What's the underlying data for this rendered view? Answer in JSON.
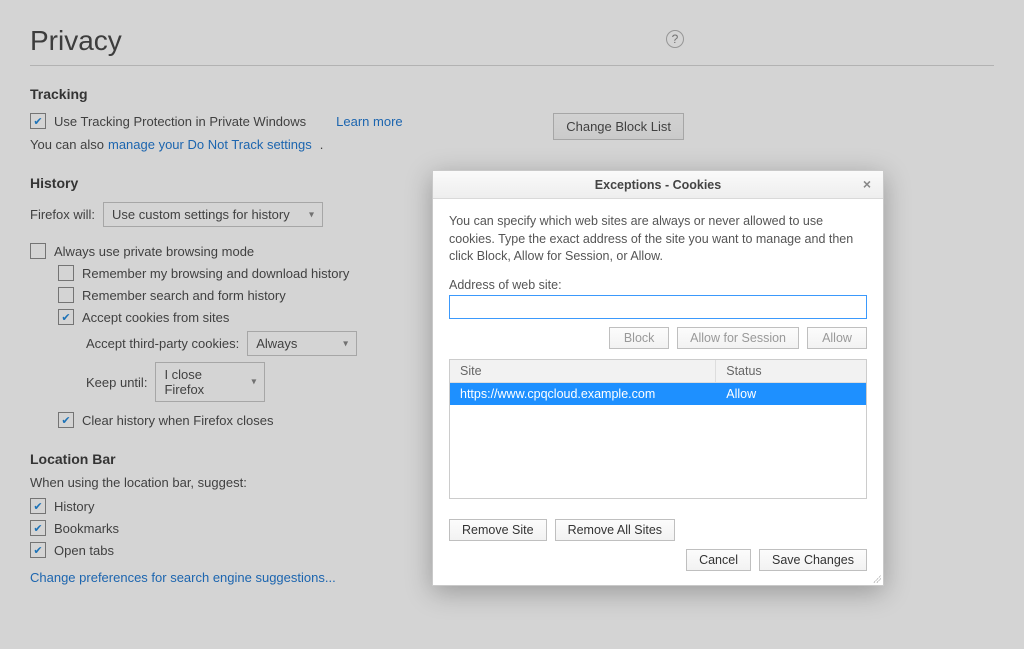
{
  "page": {
    "title": "Privacy",
    "help_icon_glyph": "?"
  },
  "tracking": {
    "heading": "Tracking",
    "use_private_label": "Use Tracking Protection in Private Windows",
    "learn_more": "Learn more",
    "change_block_list": "Change Block List",
    "manage_prefix": "You can also ",
    "manage_link": "manage your Do Not Track settings",
    "manage_suffix": "."
  },
  "history": {
    "heading": "History",
    "firefox_will_label": "Firefox will:",
    "firefox_will_value": "Use custom settings for history",
    "always_private": "Always use private browsing mode",
    "remember_browsing": "Remember my browsing and download history",
    "remember_search": "Remember search and form history",
    "accept_cookies": "Accept cookies from sites",
    "accept_third_label": "Accept third-party cookies:",
    "accept_third_value": "Always",
    "keep_until_label": "Keep until:",
    "keep_until_value": "I close Firefox",
    "clear_history": "Clear history when Firefox closes"
  },
  "locationbar": {
    "heading": "Location Bar",
    "desc": "When using the location bar, suggest:",
    "history": "History",
    "bookmarks": "Bookmarks",
    "open_tabs": "Open tabs",
    "change_search_prefs": "Change preferences for search engine suggestions..."
  },
  "modal": {
    "title": "Exceptions - Cookies",
    "desc": "You can specify which web sites are always or never allowed to use cookies. Type the exact address of the site you want to manage and then click Block, Allow for Session, or Allow.",
    "address_label": "Address of web site:",
    "address_value": "",
    "block": "Block",
    "allow_session": "Allow for Session",
    "allow": "Allow",
    "col_site": "Site",
    "col_status": "Status",
    "row_site": "https://www.cpqcloud.example.com",
    "row_status": "Allow",
    "remove_site": "Remove Site",
    "remove_all": "Remove All Sites",
    "cancel": "Cancel",
    "save": "Save Changes"
  }
}
